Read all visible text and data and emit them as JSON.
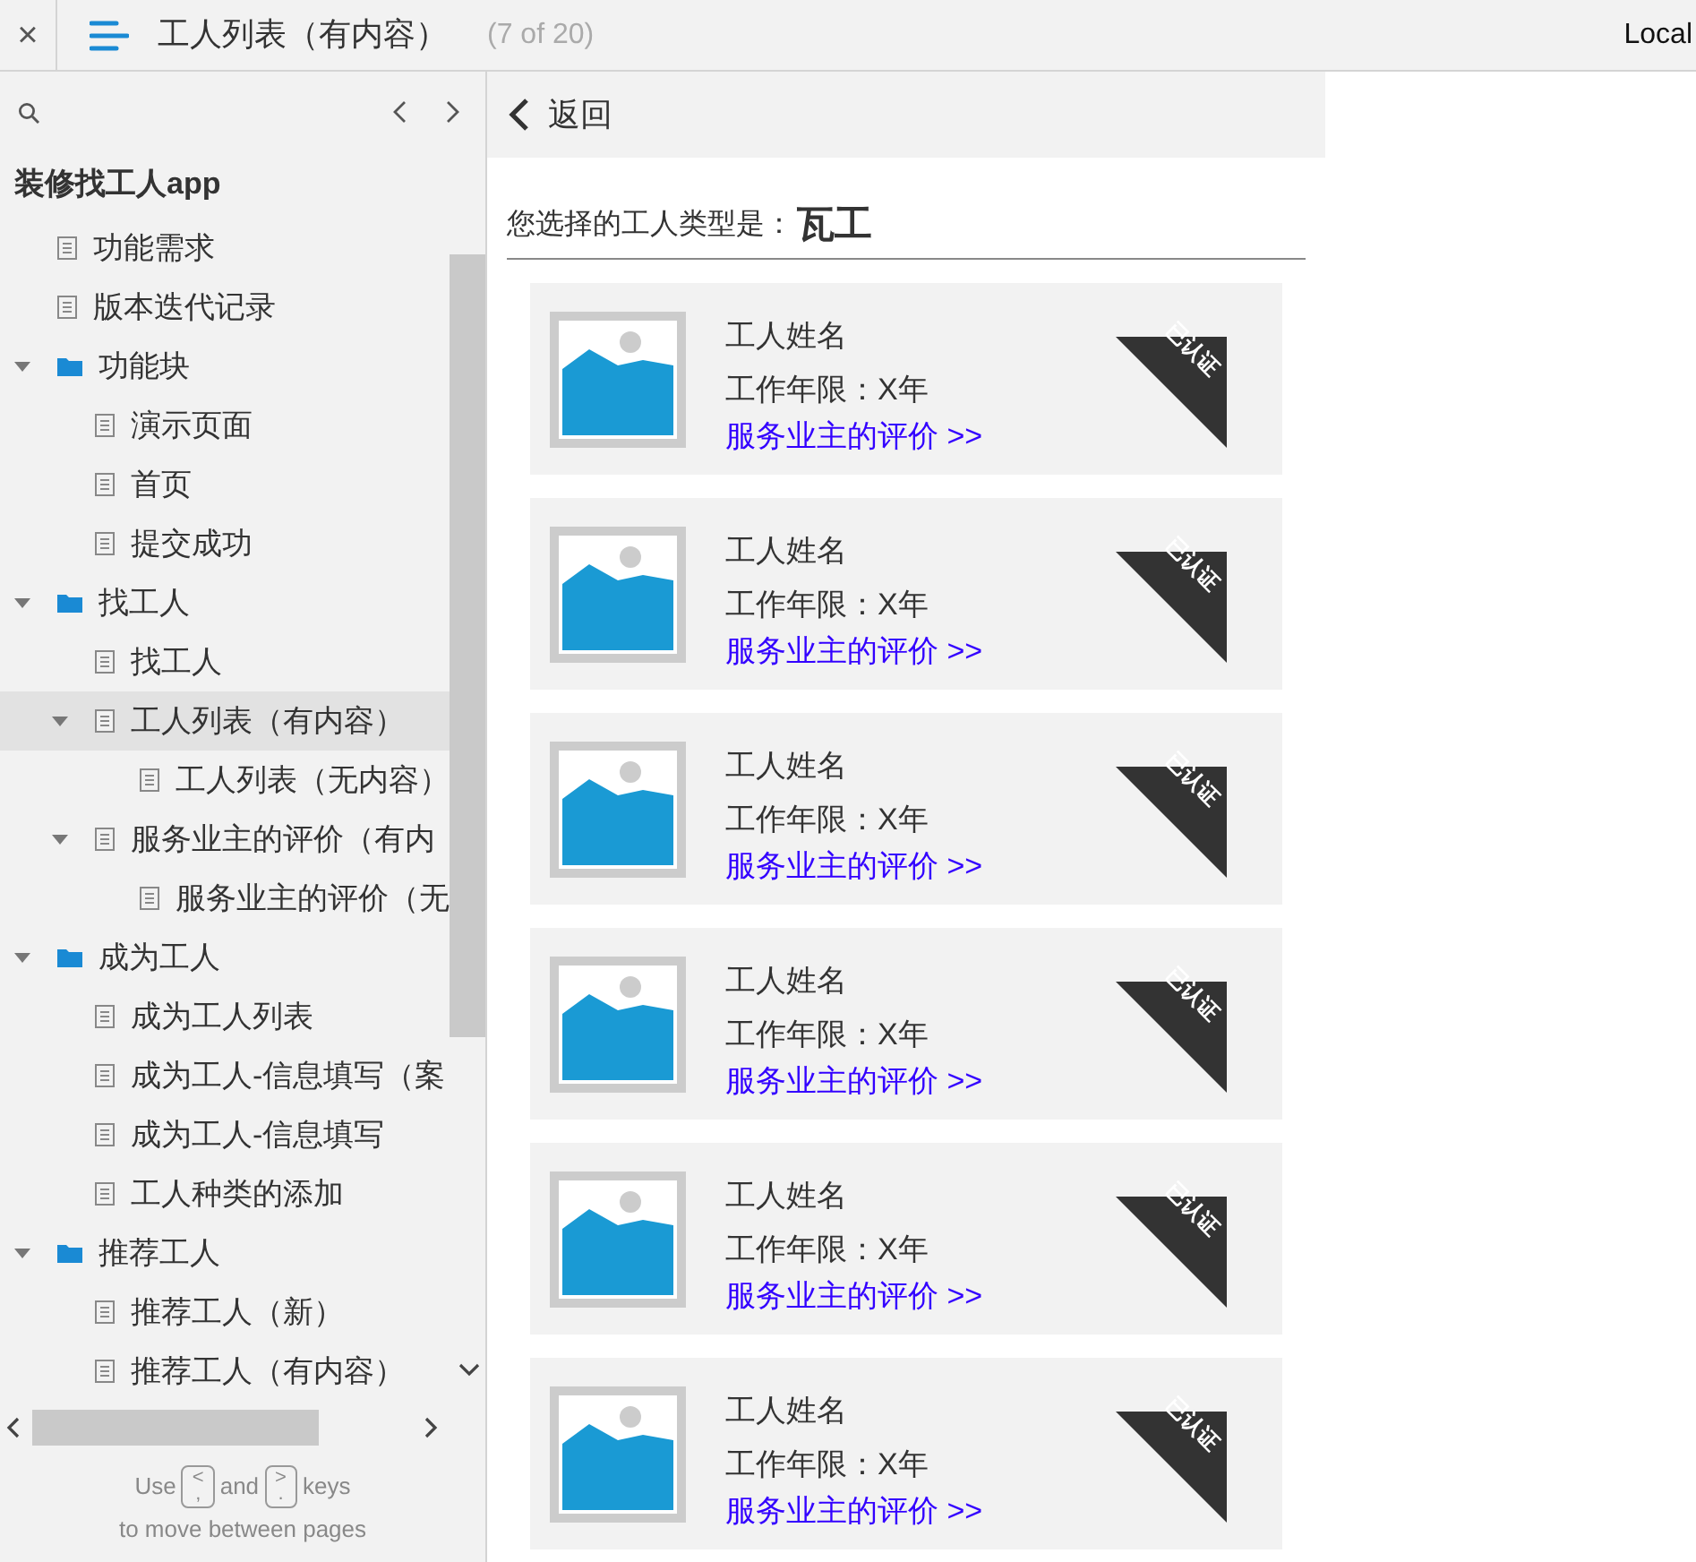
{
  "topbar": {
    "close": "×",
    "title": "工人列表（有内容）",
    "counter": "(7 of 20)",
    "right_label": "Local"
  },
  "sidebar": {
    "project": "装修找工人app",
    "items": [
      {
        "kind": "page",
        "label": "功能需求",
        "selected": false
      },
      {
        "kind": "page",
        "label": "版本迭代记录",
        "selected": false
      },
      {
        "kind": "folder",
        "label": "功能块",
        "expanded": true,
        "selected": false,
        "children": [
          {
            "kind": "page",
            "label": "演示页面",
            "selected": false
          },
          {
            "kind": "page",
            "label": "首页",
            "selected": false
          },
          {
            "kind": "page",
            "label": "提交成功",
            "selected": false
          }
        ]
      },
      {
        "kind": "folder",
        "label": "找工人",
        "expanded": true,
        "selected": false,
        "children": [
          {
            "kind": "page",
            "label": "找工人",
            "selected": false
          },
          {
            "kind": "page",
            "label": "工人列表（有内容）",
            "selected": true,
            "expanded": true,
            "children": [
              {
                "kind": "page",
                "label": "工人列表（无内容）",
                "selected": false
              }
            ]
          },
          {
            "kind": "page",
            "label": "服务业主的评价（有内",
            "selected": false,
            "expanded": true,
            "children": [
              {
                "kind": "page",
                "label": "服务业主的评价（无",
                "selected": false
              }
            ]
          }
        ]
      },
      {
        "kind": "folder",
        "label": "成为工人",
        "expanded": true,
        "selected": false,
        "children": [
          {
            "kind": "page",
            "label": "成为工人列表",
            "selected": false
          },
          {
            "kind": "page",
            "label": "成为工人-信息填写（案",
            "selected": false
          },
          {
            "kind": "page",
            "label": "成为工人-信息填写",
            "selected": false
          },
          {
            "kind": "page",
            "label": "工人种类的添加",
            "selected": false
          }
        ]
      },
      {
        "kind": "folder",
        "label": "推荐工人",
        "expanded": true,
        "selected": false,
        "children": [
          {
            "kind": "page",
            "label": "推荐工人（新）",
            "selected": false
          },
          {
            "kind": "page",
            "label": "推荐工人（有内容）",
            "selected": false
          }
        ]
      }
    ],
    "hint": {
      "use": "Use",
      "key_prev": "<",
      "key_prev_alt": ",",
      "and": "and",
      "key_next": ">",
      "key_next_alt": ".",
      "keys": "keys",
      "line2": "to move between pages"
    }
  },
  "page": {
    "back": "返回",
    "type_label": "您选择的工人类型是：",
    "type_value": "瓦工",
    "workers": [
      {
        "name": "工人姓名",
        "years": "工作年限：X年",
        "reviews": "服务业主的评价 >>",
        "badge": "已认证"
      },
      {
        "name": "工人姓名",
        "years": "工作年限：X年",
        "reviews": "服务业主的评价 >>",
        "badge": "已认证"
      },
      {
        "name": "工人姓名",
        "years": "工作年限：X年",
        "reviews": "服务业主的评价 >>",
        "badge": "已认证"
      },
      {
        "name": "工人姓名",
        "years": "工作年限：X年",
        "reviews": "服务业主的评价 >>",
        "badge": "已认证"
      },
      {
        "name": "工人姓名",
        "years": "工作年限：X年",
        "reviews": "服务业主的评价 >>",
        "badge": "已认证"
      },
      {
        "name": "工人姓名",
        "years": "工作年限：X年",
        "reviews": "服务业主的评价 >>",
        "badge": "已认证"
      }
    ]
  }
}
